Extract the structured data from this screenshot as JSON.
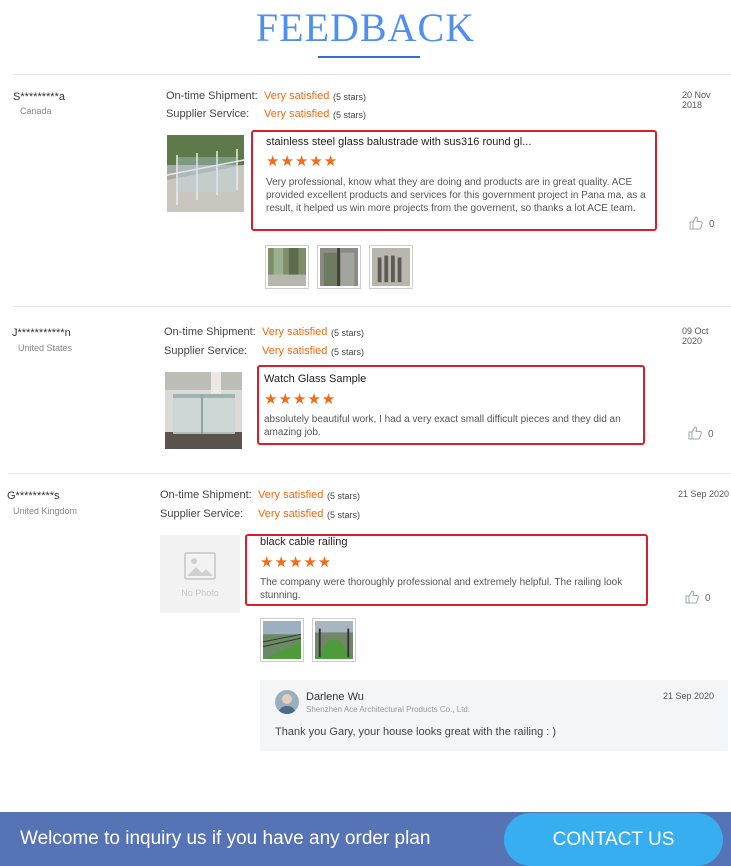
{
  "header": {
    "title": "FEEDBACK"
  },
  "reviews": [
    {
      "user": "S*********a",
      "country": "Canada",
      "date": "20 Nov 2018",
      "shipment_label": "On-time Shipment:",
      "shipment_value": "Very satisfied",
      "shipment_stars": "(5 stars)",
      "service_label": "Supplier Service:",
      "service_value": "Very satisfied",
      "service_stars": "(5 stars)",
      "product_title": "stainless steel glass balustrade with sus316 round gl...",
      "rating": 5,
      "text": "Very professional, know what they are doing and products are in great quality. ACE provided excellent products and services for this government project in Pana ma, as a result, it helped us win more projects from the governent, so thanks a lot ACE team.",
      "likes": "0"
    },
    {
      "user": "J***********n",
      "country": "United States",
      "date": "09 Oct 2020",
      "shipment_label": "On-time Shipment:",
      "shipment_value": "Very satisfied",
      "shipment_stars": "(5 stars)",
      "service_label": "Supplier Service:",
      "service_value": "Very satisfied",
      "service_stars": "(5 stars)",
      "product_title": "Watch Glass Sample",
      "rating": 5,
      "text": "absolutely beautiful work, I had a very exact small difficult pieces and they did an amazing job.",
      "likes": "0"
    },
    {
      "user": "G*********s",
      "country": "United Kingdom",
      "date": "21 Sep 2020",
      "shipment_label": "On-time Shipment:",
      "shipment_value": "Very satisfied",
      "shipment_stars": "(5 stars)",
      "service_label": "Supplier Service:",
      "service_value": "Very satisfied",
      "service_stars": "(5 stars)",
      "product_title": "black cable railing",
      "rating": 5,
      "text": "The company were thoroughly professional and extremely helpful. The railing look stunning.",
      "likes": "0",
      "no_photo_label": "No Photo",
      "reply": {
        "name": "Darlene Wu",
        "company": "Shenzhen Ace Architectural Products Co., Ltd.",
        "date": "21 Sep 2020",
        "text": "Thank you Gary, your house looks great with the railing : )"
      }
    }
  ],
  "banner": {
    "text": "Welcome to inquiry us if you have any order plan",
    "button": "CONTACT US"
  },
  "icons": {
    "like": "thumbs-up-icon",
    "avatar": "avatar-icon",
    "placeholder": "image-placeholder-icon"
  },
  "colors": {
    "title": "#4f8ff0",
    "satisfied": "#ee6a12",
    "stars": "#f36a17",
    "highlight_border": "#d81e2a",
    "banner": "#5673b5",
    "button": "#37aef0"
  }
}
